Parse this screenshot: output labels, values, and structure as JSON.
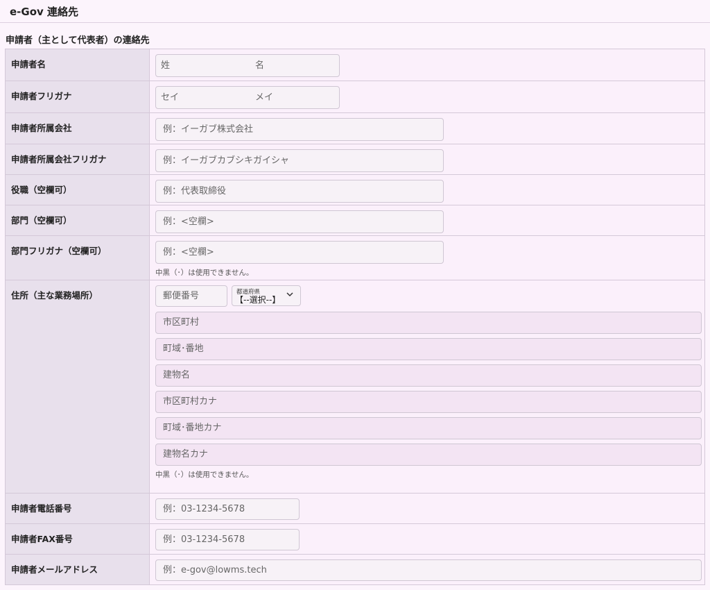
{
  "header": {
    "title": "e-Gov 連絡先"
  },
  "section": {
    "title": "申請者（主として代表者）の連絡先"
  },
  "rows": {
    "name": {
      "label": "申請者名",
      "sei_placeholder": "姓",
      "mei_placeholder": "名"
    },
    "furigana": {
      "label": "申請者フリガナ",
      "sei_placeholder": "セイ",
      "mei_placeholder": "メイ"
    },
    "company": {
      "label": "申請者所属会社",
      "placeholder": "例：イーガブ株式会社"
    },
    "company_kana": {
      "label": "申請者所属会社フリガナ",
      "placeholder": "例：イーガブカブシキガイシャ"
    },
    "position": {
      "label": "役職（空欄可）",
      "placeholder": "例：代表取締役"
    },
    "department": {
      "label": "部門（空欄可）",
      "placeholder": "例：<空欄>"
    },
    "department_kana": {
      "label": "部門フリガナ（空欄可）",
      "placeholder": "例：<空欄>",
      "hint": "中黒（･）は使用できません。"
    },
    "address": {
      "label": "住所（主な業務場所）",
      "postal_placeholder": "郵便番号",
      "prefecture_caption": "都道府県",
      "prefecture_value": "【--選択--】",
      "city_placeholder": "市区町村",
      "street_placeholder": "町域･番地",
      "building_placeholder": "建物名",
      "city_kana_placeholder": "市区町村カナ",
      "street_kana_placeholder": "町域･番地カナ",
      "building_kana_placeholder": "建物名カナ",
      "hint": "中黒（･）は使用できません。"
    },
    "phone": {
      "label": "申請者電話番号",
      "placeholder": "例：03-1234-5678"
    },
    "fax": {
      "label": "申請者FAX番号",
      "placeholder": "例：03-1234-5678"
    },
    "email": {
      "label": "申請者メールアドレス",
      "placeholder": "例：e-gov@lowms.tech"
    }
  },
  "icons": {
    "select_arrow": "chevron-down-icon"
  },
  "colors": {
    "background": "#fcf4fc",
    "label_cell": "#e8e0ec",
    "input_bg": "#f7f2f7",
    "address_input_bg": "#f3e4f3"
  }
}
